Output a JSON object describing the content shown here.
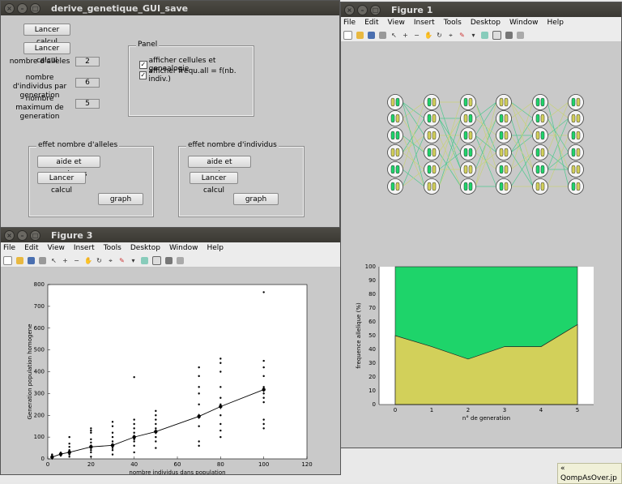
{
  "gui": {
    "title": "derive_genetique_GUI_save",
    "btn_calc1": "Lancer calcul",
    "btn_calc2": "Lancer calcul",
    "label_alleles": "nombre d'alleles",
    "value_alleles": "2",
    "label_indiv": "nombre d'individus par generation",
    "value_indiv": "6",
    "label_maxgen": "nombre maximum de generation",
    "value_maxgen": "5",
    "panel_title": "Panel",
    "check1": "afficher cellules et genealogie",
    "check2": "afficher frequ.all = f(nb. indiv.)",
    "panel_alleles": {
      "title": "effet nombre d'alleles",
      "help": "aide et consignes",
      "calc": "Lancer calcul",
      "graph": "graph"
    },
    "panel_indiv": {
      "title": "effet nombre d'individus",
      "help": "aide et consignes",
      "calc": "Lancer calcul",
      "graph": "graph"
    }
  },
  "fig1": {
    "title": "Figure 1",
    "menu": [
      "File",
      "Edit",
      "View",
      "Insert",
      "Tools",
      "Desktop",
      "Window",
      "Help"
    ],
    "colors": {
      "green": "#1ed46a",
      "yellow": "#d2d05a"
    },
    "area_chart": {
      "type": "area",
      "x": [
        0,
        1,
        2,
        3,
        4,
        5
      ],
      "allele1": [
        50,
        42,
        33,
        42,
        42,
        58
      ],
      "ylabel": "frequence allelique (%)",
      "xlabel": "n° de generation",
      "xlim": [
        0,
        5
      ],
      "ylim": [
        0,
        100
      ],
      "yticks": [
        0,
        10,
        20,
        30,
        40,
        50,
        60,
        70,
        80,
        90,
        100
      ],
      "xticks": [
        0,
        1,
        2,
        3,
        4,
        5
      ]
    }
  },
  "fig3": {
    "title": "Figure 3",
    "menu": [
      "File",
      "Edit",
      "View",
      "Insert",
      "Tools",
      "Desktop",
      "Window",
      "Help"
    ]
  },
  "chart_data": {
    "type": "scatter",
    "xlabel": "nombre individus dans population",
    "ylabel": "Generation population homogene",
    "xlim": [
      0,
      120
    ],
    "ylim": [
      0,
      800
    ],
    "xticks": [
      0,
      20,
      40,
      60,
      80,
      100,
      120
    ],
    "yticks": [
      0,
      100,
      200,
      300,
      400,
      500,
      600,
      700,
      800
    ],
    "mean_series": {
      "x": [
        2,
        6,
        10,
        20,
        30,
        40,
        50,
        70,
        80,
        100
      ],
      "y": [
        8,
        22,
        30,
        55,
        62,
        100,
        125,
        195,
        240,
        318
      ]
    },
    "points": [
      [
        2,
        3
      ],
      [
        2,
        8
      ],
      [
        2,
        12
      ],
      [
        2,
        20
      ],
      [
        2,
        5
      ],
      [
        2,
        15
      ],
      [
        6,
        15
      ],
      [
        6,
        22
      ],
      [
        6,
        28
      ],
      [
        6,
        20
      ],
      [
        10,
        10
      ],
      [
        10,
        20
      ],
      [
        10,
        30
      ],
      [
        10,
        40
      ],
      [
        10,
        55
      ],
      [
        10,
        70
      ],
      [
        10,
        100
      ],
      [
        10,
        25
      ],
      [
        10,
        35
      ],
      [
        20,
        10
      ],
      [
        20,
        30
      ],
      [
        20,
        50
      ],
      [
        20,
        60
      ],
      [
        20,
        75
      ],
      [
        20,
        90
      ],
      [
        20,
        120
      ],
      [
        20,
        130
      ],
      [
        20,
        140
      ],
      [
        20,
        40
      ],
      [
        30,
        20
      ],
      [
        30,
        40
      ],
      [
        30,
        60
      ],
      [
        30,
        80
      ],
      [
        30,
        100
      ],
      [
        30,
        120
      ],
      [
        30,
        150
      ],
      [
        30,
        170
      ],
      [
        30,
        50
      ],
      [
        40,
        30
      ],
      [
        40,
        60
      ],
      [
        40,
        80
      ],
      [
        40,
        100
      ],
      [
        40,
        120
      ],
      [
        40,
        140
      ],
      [
        40,
        160
      ],
      [
        40,
        180
      ],
      [
        40,
        375
      ],
      [
        40,
        90
      ],
      [
        50,
        50
      ],
      [
        50,
        80
      ],
      [
        50,
        100
      ],
      [
        50,
        120
      ],
      [
        50,
        140
      ],
      [
        50,
        160
      ],
      [
        50,
        180
      ],
      [
        50,
        200
      ],
      [
        50,
        220
      ],
      [
        70,
        60
      ],
      [
        70,
        80
      ],
      [
        70,
        150
      ],
      [
        70,
        190
      ],
      [
        70,
        200
      ],
      [
        70,
        250
      ],
      [
        70,
        300
      ],
      [
        70,
        330
      ],
      [
        70,
        380
      ],
      [
        70,
        420
      ],
      [
        80,
        100
      ],
      [
        80,
        130
      ],
      [
        80,
        160
      ],
      [
        80,
        200
      ],
      [
        80,
        250
      ],
      [
        80,
        280
      ],
      [
        80,
        330
      ],
      [
        80,
        400
      ],
      [
        80,
        440
      ],
      [
        80,
        460
      ],
      [
        100,
        140
      ],
      [
        100,
        160
      ],
      [
        100,
        180
      ],
      [
        100,
        260
      ],
      [
        100,
        280
      ],
      [
        100,
        300
      ],
      [
        100,
        330
      ],
      [
        100,
        380
      ],
      [
        100,
        420
      ],
      [
        100,
        450
      ],
      [
        100,
        765
      ]
    ]
  },
  "taskbar_item": "« QompAsOver.jp"
}
